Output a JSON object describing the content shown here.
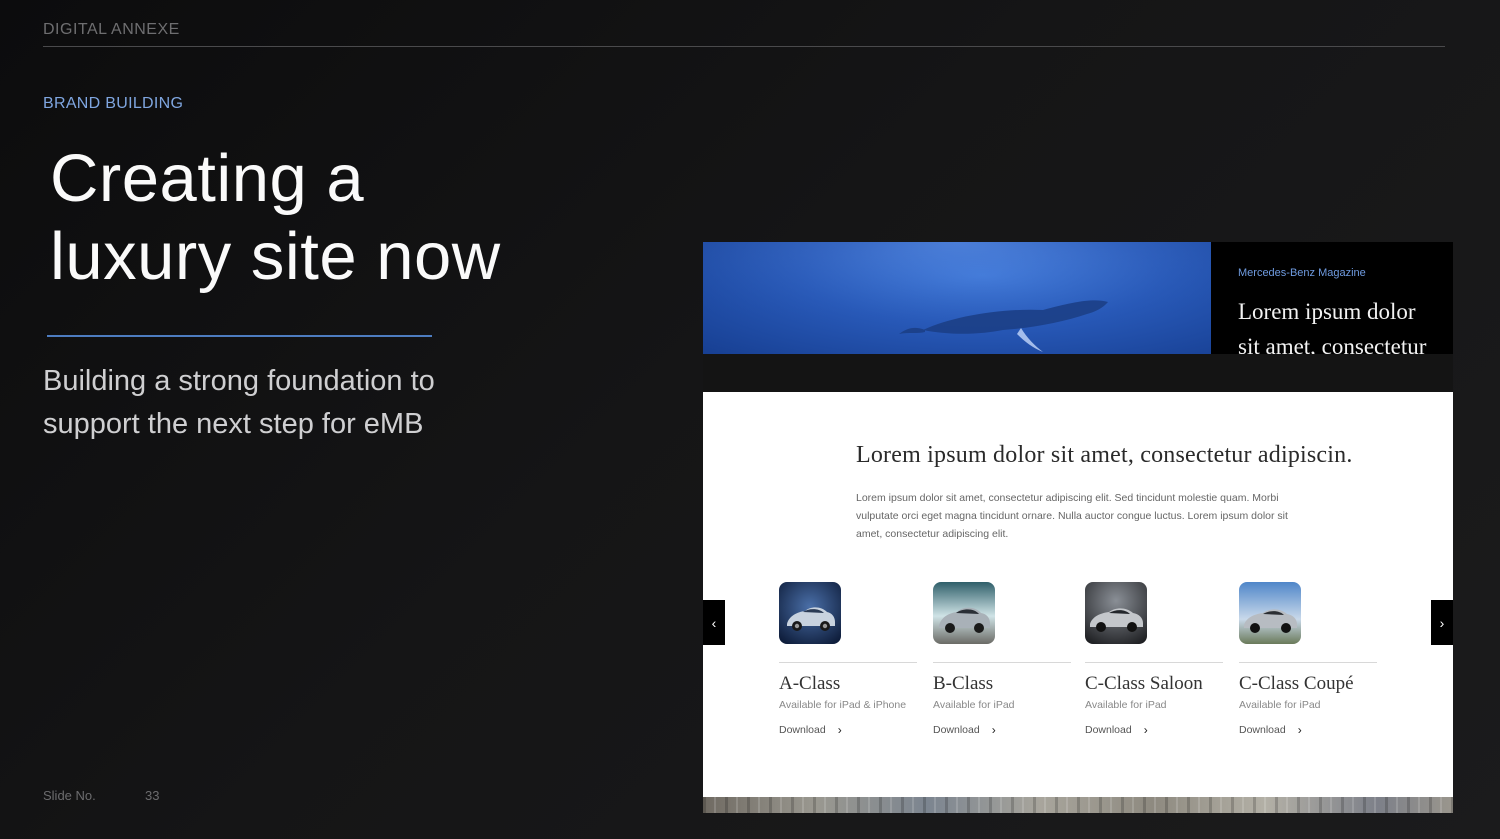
{
  "slide": {
    "section_label": "DIGITAL ANNEXE",
    "eyebrow": "BRAND BUILDING",
    "headline_line1": "Creating a",
    "headline_line2": "luxury site now",
    "subhead_line1": "Building a strong foundation to",
    "subhead_line2": "support the next step for eMB",
    "slide_label": "Slide No.",
    "slide_number": "33",
    "accent_color": "#4d7cc0",
    "eyebrow_color": "#7fa6e0"
  },
  "mockup": {
    "magazine": {
      "label": "Mercedes-Benz Magazine",
      "title": "Lorem ipsum dolor sit amet, consectetur"
    },
    "intro": {
      "title": "Lorem ipsum dolor sit amet, consectetur adipiscin.",
      "body": "Lorem ipsum dolor sit amet, consectetur adipiscing elit. Sed tincidunt molestie quam. Morbi vulputate orci eget magna tincidunt ornare. Nulla auctor congue luctus. Lorem ipsum dolor sit amet, consectetur adipiscing elit."
    },
    "carousel": {
      "prev_icon": "chevron-left-icon",
      "next_icon": "chevron-right-icon",
      "prev_glyph": "‹",
      "next_glyph": "›",
      "chevron_glyph": "›",
      "apps": [
        {
          "name": "A-Class",
          "availability": "Available for iPad & iPhone",
          "download": "Download",
          "icon": "a-class-car-icon"
        },
        {
          "name": "B-Class",
          "availability": "Available for iPad",
          "download": "Download",
          "icon": "b-class-car-icon"
        },
        {
          "name": "C-Class Saloon",
          "availability": "Available for iPad",
          "download": "Download",
          "icon": "c-class-saloon-car-icon"
        },
        {
          "name": "C-Class Coupé",
          "availability": "Available for iPad",
          "download": "Download",
          "icon": "c-class-coupe-car-icon"
        }
      ]
    }
  }
}
